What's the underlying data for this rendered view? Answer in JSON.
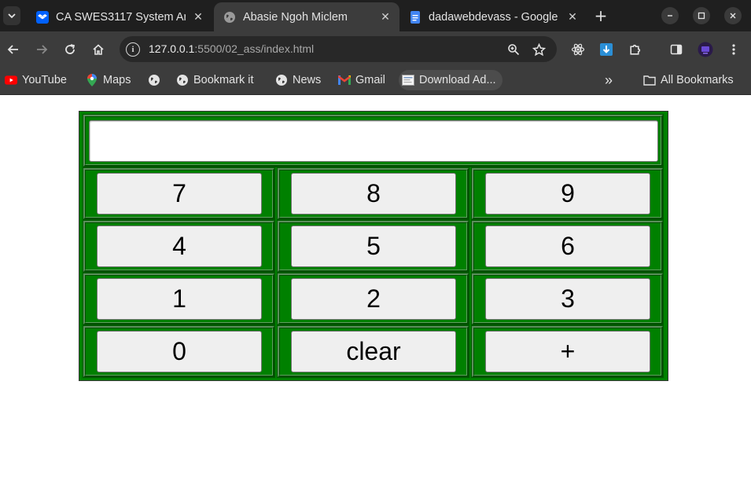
{
  "browser": {
    "tabs": [
      {
        "title": "CA SWES3117 System An",
        "favicon": "dropbox-icon",
        "active": false
      },
      {
        "title": "Abasie Ngoh Miclem",
        "favicon": "globe-icon",
        "active": true
      },
      {
        "title": "dadawebdevass - Google",
        "favicon": "google-docs-icon",
        "active": false
      }
    ],
    "tab_close_glyph": "✕",
    "new_tab_glyph": "+",
    "url_host": "127.0.0.1",
    "url_path": ":5500/02_ass/index.html",
    "bookmarks": [
      {
        "label": "YouTube",
        "icon": "youtube-icon"
      },
      {
        "label": "Maps",
        "icon": "maps-icon"
      },
      {
        "label": "",
        "icon": "globe-icon"
      },
      {
        "label": "Bookmark it",
        "icon": "globe-icon"
      },
      {
        "label": "News",
        "icon": "globe-icon"
      },
      {
        "label": "Gmail",
        "icon": "gmail-icon"
      },
      {
        "label": "Download Ad...",
        "icon": "page-icon"
      }
    ],
    "overflow_glyph": "»",
    "all_bookmarks": "All Bookmarks"
  },
  "calculator": {
    "display_value": "",
    "keys": [
      [
        "7",
        "8",
        "9"
      ],
      [
        "4",
        "5",
        "6"
      ],
      [
        "1",
        "2",
        "3"
      ],
      [
        "0",
        "clear",
        "+"
      ]
    ]
  },
  "colors": {
    "calculator_bg": "#008000",
    "key_bg": "#efefef",
    "chrome_dark": "#1f1f1f",
    "chrome_toolbar": "#3c3c3c"
  }
}
